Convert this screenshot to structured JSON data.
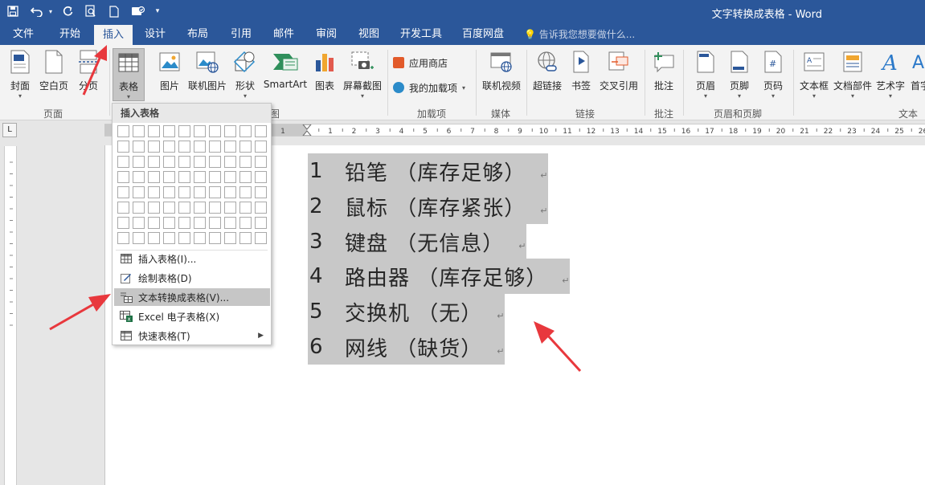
{
  "window": {
    "title": "文字转换成表格 - Word"
  },
  "quick_access": [
    "save-icon",
    "undo-icon",
    "redo-icon",
    "print-preview-icon",
    "new-doc-icon",
    "touch-mode-icon",
    "customize-icon"
  ],
  "tabs": [
    {
      "label": "文件"
    },
    {
      "label": "开始"
    },
    {
      "label": "插入"
    },
    {
      "label": "设计"
    },
    {
      "label": "布局"
    },
    {
      "label": "引用"
    },
    {
      "label": "邮件"
    },
    {
      "label": "审阅"
    },
    {
      "label": "视图"
    },
    {
      "label": "开发工具"
    },
    {
      "label": "百度网盘"
    }
  ],
  "active_tab": "插入",
  "tell_me": "告诉我您想要做什么...",
  "ribbon": {
    "pages": {
      "label": "页面",
      "cover": "封面",
      "blank": "空白页",
      "break": "分页"
    },
    "tables": {
      "label": "表格"
    },
    "illustrations": {
      "label": "图",
      "picture": "图片",
      "online_picture": "联机图片",
      "shapes": "形状",
      "smartart": "SmartArt",
      "chart": "图表",
      "screenshot": "屏幕截图"
    },
    "addins": {
      "label": "加载项",
      "store": "应用商店",
      "my_addins": "我的加载项"
    },
    "media": {
      "label": "媒体",
      "online_video": "联机视频"
    },
    "links": {
      "label": "链接",
      "hyperlink": "超链接",
      "bookmark": "书签",
      "crossref": "交叉引用"
    },
    "comments": {
      "label": "批注",
      "comment": "批注"
    },
    "header_footer": {
      "label": "页眉和页脚",
      "header": "页眉",
      "footer": "页脚",
      "page_number": "页码"
    },
    "text": {
      "label": "文本",
      "textbox": "文本框",
      "quickparts": "文档部件",
      "wordart": "艺术字",
      "dropcap": "首字"
    }
  },
  "dropdown": {
    "header": "插入表格",
    "grid": {
      "cols": 10,
      "rows": 8
    },
    "items": [
      {
        "label": "插入表格(I)..."
      },
      {
        "label": "绘制表格(D)"
      },
      {
        "label": "文本转换成表格(V)..."
      },
      {
        "label": "Excel 电子表格(X)"
      },
      {
        "label": "快速表格(T)"
      }
    ],
    "highlighted": "文本转换成表格(V)..."
  },
  "ruler": {
    "marks": [
      "1",
      "1",
      "2",
      "3",
      "4",
      "5",
      "6",
      "7",
      "8",
      "9",
      "10",
      "11",
      "12",
      "13",
      "14",
      "15",
      "16",
      "17",
      "18",
      "19",
      "20",
      "21",
      "22",
      "23",
      "24",
      "25",
      "26"
    ]
  },
  "document": {
    "lines": [
      {
        "num": "1",
        "text": "铅笔 （库存足够）"
      },
      {
        "num": "2",
        "text": "鼠标 （库存紧张）"
      },
      {
        "num": "3",
        "text": "键盘 （无信息）"
      },
      {
        "num": "4",
        "text": "路由器 （库存足够）"
      },
      {
        "num": "5",
        "text": "交换机 （无）"
      },
      {
        "num": "6",
        "text": "网线 （缺货）"
      }
    ],
    "paragraph_mark": "↵",
    "selection_color": "#c8c8c8"
  },
  "colors": {
    "brand": "#2b579a",
    "ribbon_bg": "#f3f3f3",
    "annotation_arrow": "#e8383d"
  }
}
